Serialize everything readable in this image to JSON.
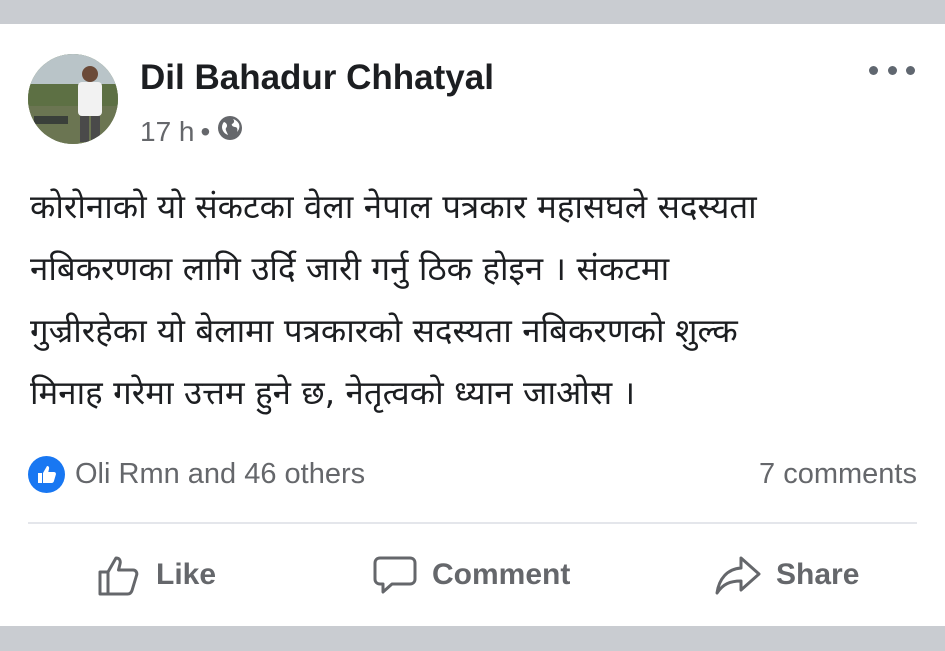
{
  "post": {
    "author": "Dil Bahadur Chhatyal",
    "time": "17 h",
    "separator": "•",
    "privacy_icon": "globe-icon",
    "options_icon": "more-options-icon",
    "text_lines": [
      "कोरोनाको यो संकटका वेला नेपाल पत्रकार महासघले सदस्यता",
      "नबिकरणका लागि उर्दि जारी गर्नु ठिक होइन । संकटमा",
      "गुज्रीरहेका यो बेलामा पत्रकारको सदस्यता नबिकरणको शुल्क",
      "मिनाह गरेमा उत्तम हुने छ, नेतृत्वको ध्यान जाओस ।"
    ]
  },
  "stats": {
    "reactions": "Oli Rmn and 46 others",
    "comments": "7 comments",
    "reaction_icon": "like-reaction-icon"
  },
  "actions": {
    "like": "Like",
    "comment": "Comment",
    "share": "Share"
  },
  "colors": {
    "background": "#c9ccd1",
    "card": "#ffffff",
    "text": "#1c1e21",
    "secondary_text": "#65676b",
    "accent": "#1877f2"
  }
}
